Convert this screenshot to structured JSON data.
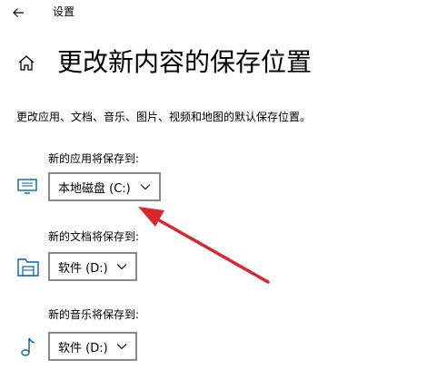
{
  "window": {
    "title": "设置"
  },
  "page": {
    "title": "更改新内容的保存位置",
    "description": "更改应用、文档、音乐、图片、视频和地图的默认保存位置。"
  },
  "sections": [
    {
      "label": "新的应用将保存到:",
      "value": "本地磁盘 (C:)",
      "icon": "monitor-icon"
    },
    {
      "label": "新的文档将保存到:",
      "value": "软件 (D:)",
      "icon": "folder-icon"
    },
    {
      "label": "新的音乐将保存到:",
      "value": "软件 (D:)",
      "icon": "music-note-icon"
    }
  ],
  "colors": {
    "accent": "#0063b1",
    "annotation": "#d9272e",
    "border": "#8a8a8a"
  }
}
